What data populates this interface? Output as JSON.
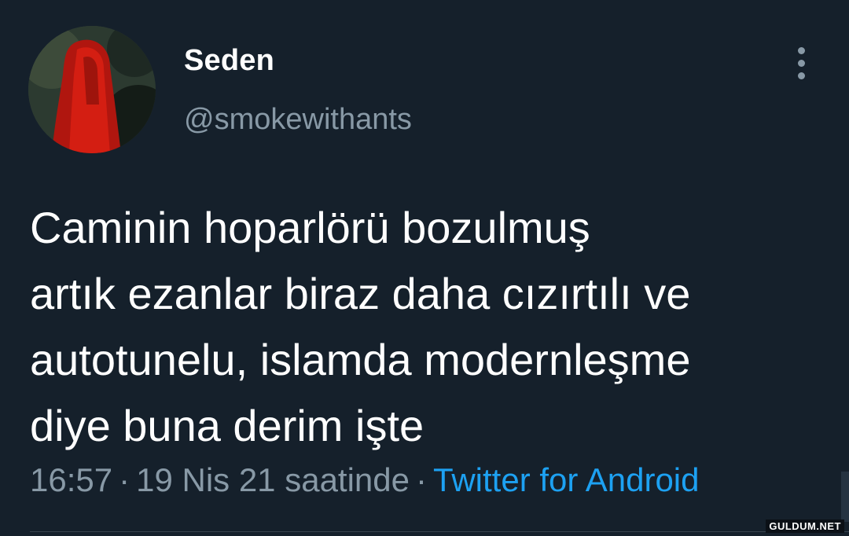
{
  "tweet": {
    "author": {
      "display_name": "Seden",
      "handle": "@smokewithants"
    },
    "text_lines": [
      "Caminin hoparlörü bozulmuş",
      "artık ezanlar biraz daha cızırtılı ve",
      "autotunelu, islamda modernleşme",
      "diye buna derim işte"
    ],
    "meta": {
      "time": "16:57",
      "separator": "·",
      "date_text": "19 Nis 21 saatinde",
      "source": "Twitter for Android"
    },
    "more_icon": "more-vertical-icon"
  },
  "watermark": "GULDUM.NET",
  "colors": {
    "background": "#15202b",
    "primary_text": "#ffffff",
    "secondary_text": "#8899a6",
    "accent": "#1da1f2"
  }
}
